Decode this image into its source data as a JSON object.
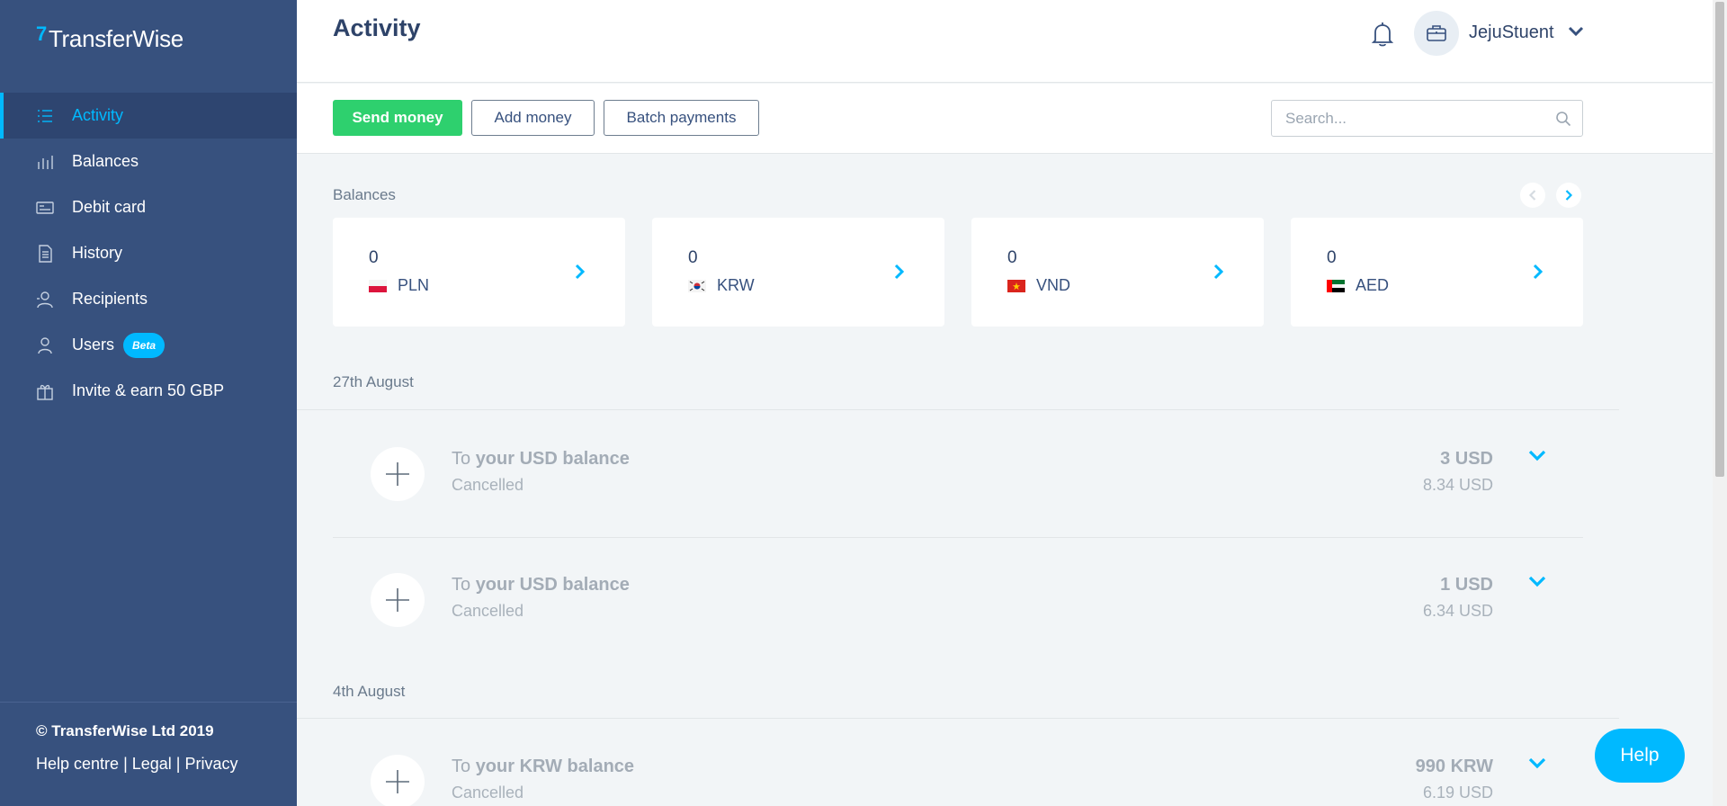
{
  "app": {
    "logo_text": "TransferWise",
    "logo_mark": "7"
  },
  "sidebar": {
    "items": [
      {
        "label": "Activity",
        "icon": "list-icon",
        "active": true
      },
      {
        "label": "Balances",
        "icon": "bar-chart-icon"
      },
      {
        "label": "Debit card",
        "icon": "card-icon"
      },
      {
        "label": "History",
        "icon": "document-icon"
      },
      {
        "label": "Recipients",
        "icon": "recipients-icon"
      },
      {
        "label": "Users",
        "icon": "user-icon",
        "badge": "Beta"
      },
      {
        "label": "Invite & earn 50 GBP",
        "icon": "gift-icon"
      }
    ],
    "footer": {
      "copyright": "© TransferWise Ltd 2019",
      "links": [
        "Help centre",
        "Legal",
        "Privacy"
      ],
      "separator": " | "
    }
  },
  "header": {
    "title": "Activity",
    "profile_name": "JejuStuent"
  },
  "toolbar": {
    "send_label": "Send money",
    "add_label": "Add money",
    "batch_label": "Batch payments",
    "search_placeholder": "Search..."
  },
  "balances": {
    "label": "Balances",
    "cards": [
      {
        "amount": "0",
        "currency": "PLN",
        "flag": "pl"
      },
      {
        "amount": "0",
        "currency": "KRW",
        "flag": "kr"
      },
      {
        "amount": "0",
        "currency": "VND",
        "flag": "vn"
      },
      {
        "amount": "0",
        "currency": "AED",
        "flag": "ae"
      }
    ]
  },
  "activity": {
    "groups": [
      {
        "date": "27th August",
        "transactions": [
          {
            "prefix": "To ",
            "target": "your USD balance",
            "status": "Cancelled",
            "amount": "3 USD",
            "sub": "8.34 USD"
          },
          {
            "prefix": "To ",
            "target": "your USD balance",
            "status": "Cancelled",
            "amount": "1 USD",
            "sub": "6.34 USD"
          }
        ]
      },
      {
        "date": "4th August",
        "transactions": [
          {
            "prefix": "To ",
            "target": "your KRW balance",
            "status": "Cancelled",
            "amount": "990 KRW",
            "sub": "6.19 USD"
          }
        ]
      }
    ]
  },
  "help": {
    "label": "Help"
  },
  "colors": {
    "sidebar_bg": "#37517e",
    "accent": "#00b9ff",
    "primary_button": "#2ed06e"
  }
}
